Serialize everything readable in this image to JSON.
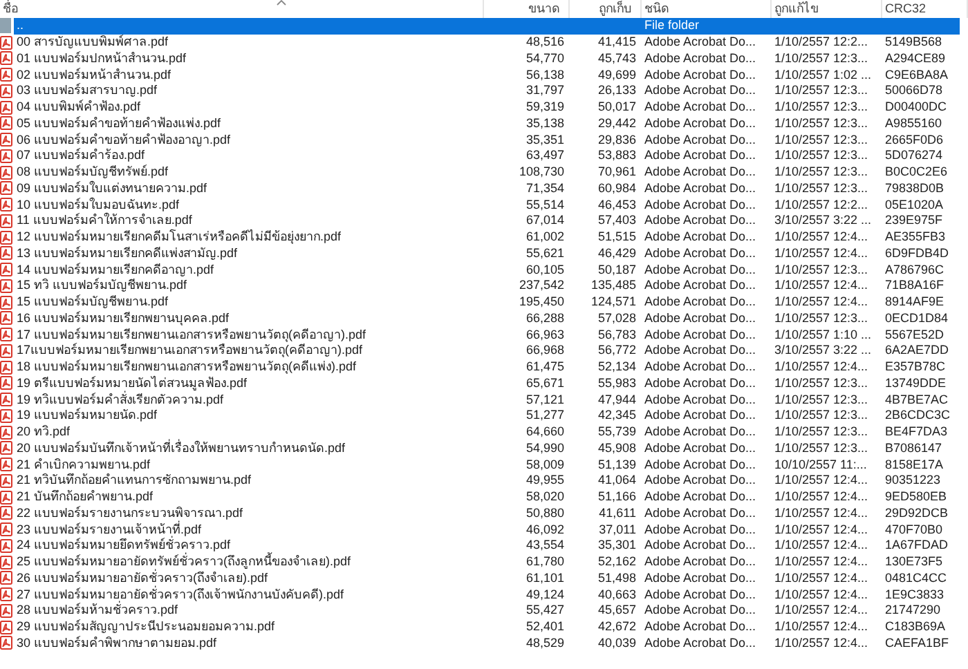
{
  "columns": [
    "ชื่อ",
    "ขนาด",
    "ถูกเก็บ",
    "ชนิด",
    "ถูกแก้ไข",
    "CRC32"
  ],
  "rows": [
    {
      "kind": "folder",
      "name": "..",
      "type": "File folder",
      "selected": true
    },
    {
      "kind": "pdf",
      "name": "00 สารบัญแบบพิมพ์ศาล.pdf",
      "size": "48,516",
      "packed": "41,415",
      "type": "Adobe Acrobat Do...",
      "modified": "1/10/2557 12:2...",
      "crc": "5149B568",
      "selected": false
    },
    {
      "kind": "pdf",
      "name": "01 แบบฟอร์มปกหน้าสำนวน.pdf",
      "size": "54,770",
      "packed": "45,743",
      "type": "Adobe Acrobat Do...",
      "modified": "1/10/2557 12:3...",
      "crc": "A294CE89",
      "selected": false
    },
    {
      "kind": "pdf",
      "name": "02 แบบฟอร์มหน้าสำนวน.pdf",
      "size": "56,138",
      "packed": "49,699",
      "type": "Adobe Acrobat Do...",
      "modified": "1/10/2557 1:02 ...",
      "crc": "C9E6BA8A",
      "selected": false
    },
    {
      "kind": "pdf",
      "name": "03 แบบฟอร์มสารบาญ.pdf",
      "size": "31,797",
      "packed": "26,133",
      "type": "Adobe Acrobat Do...",
      "modified": "1/10/2557 12:3...",
      "crc": "50066D78",
      "selected": false
    },
    {
      "kind": "pdf",
      "name": "04 แบบพิมพ์คำฟ้อง.pdf",
      "size": "59,319",
      "packed": "50,017",
      "type": "Adobe Acrobat Do...",
      "modified": "1/10/2557 12:3...",
      "crc": "D00400DC",
      "selected": false
    },
    {
      "kind": "pdf",
      "name": "05 แบบฟอร์มคำขอท้ายคำฟ้องแพ่ง.pdf",
      "size": "35,138",
      "packed": "29,442",
      "type": "Adobe Acrobat Do...",
      "modified": "1/10/2557 12:3...",
      "crc": "A9855160",
      "selected": false
    },
    {
      "kind": "pdf",
      "name": "06 แบบฟอร์มคำขอท้ายคำฟ้องอาญา.pdf",
      "size": "35,351",
      "packed": "29,836",
      "type": "Adobe Acrobat Do...",
      "modified": "1/10/2557 12:3...",
      "crc": "2665F0D6",
      "selected": false
    },
    {
      "kind": "pdf",
      "name": "07 แบบฟอร์มคำร้อง.pdf",
      "size": "63,497",
      "packed": "53,883",
      "type": "Adobe Acrobat Do...",
      "modified": "1/10/2557 12:3...",
      "crc": "5D076274",
      "selected": false
    },
    {
      "kind": "pdf",
      "name": "08 แบบฟอร์มบัญชีทรัพย์.pdf",
      "size": "108,730",
      "packed": "70,961",
      "type": "Adobe Acrobat Do...",
      "modified": "1/10/2557 12:3...",
      "crc": "B0C0C2E6",
      "selected": false
    },
    {
      "kind": "pdf",
      "name": "09 แบบฟอร์มใบแต่งทนายความ.pdf",
      "size": "71,354",
      "packed": "60,984",
      "type": "Adobe Acrobat Do...",
      "modified": "1/10/2557 12:3...",
      "crc": "79838D0B",
      "selected": false
    },
    {
      "kind": "pdf",
      "name": "10 แบบฟอร์มใบมอบฉันทะ.pdf",
      "size": "55,514",
      "packed": "46,453",
      "type": "Adobe Acrobat Do...",
      "modified": "1/10/2557 12:2...",
      "crc": "05E1020A",
      "selected": false
    },
    {
      "kind": "pdf",
      "name": "11 แบบฟอร์มคำให้การจำเลย.pdf",
      "size": "67,014",
      "packed": "57,403",
      "type": "Adobe Acrobat Do...",
      "modified": "3/10/2557 3:22 ...",
      "crc": "239E975F",
      "selected": false
    },
    {
      "kind": "pdf",
      "name": "12 แบบฟอร์มหมายเรียกคดีมโนสาเร่หรือคดีไม่มีข้อยุ่งยาก.pdf",
      "size": "61,002",
      "packed": "51,515",
      "type": "Adobe Acrobat Do...",
      "modified": "1/10/2557 12:4...",
      "crc": "AE355FB3",
      "selected": false
    },
    {
      "kind": "pdf",
      "name": "13 แบบฟอร์มหมายเรียกคดีแพ่งสามัญ.pdf",
      "size": "55,621",
      "packed": "46,429",
      "type": "Adobe Acrobat Do...",
      "modified": "1/10/2557 12:4...",
      "crc": "6D9FDB4D",
      "selected": false
    },
    {
      "kind": "pdf",
      "name": "14 แบบฟอร์มหมายเรียกคดีอาญา.pdf",
      "size": "60,105",
      "packed": "50,187",
      "type": "Adobe Acrobat Do...",
      "modified": "1/10/2557 12:3...",
      "crc": "A786796C",
      "selected": false
    },
    {
      "kind": "pdf",
      "name": "15 ทวิ แบบฟอร์มบัญชีพยาน.pdf",
      "size": "237,542",
      "packed": "135,485",
      "type": "Adobe Acrobat Do...",
      "modified": "1/10/2557 12:4...",
      "crc": "71B8A16F",
      "selected": false
    },
    {
      "kind": "pdf",
      "name": "15 แบบฟอร์มบัญชีพยาน.pdf",
      "size": "195,450",
      "packed": "124,571",
      "type": "Adobe Acrobat Do...",
      "modified": "1/10/2557 12:4...",
      "crc": "8914AF9E",
      "selected": false
    },
    {
      "kind": "pdf",
      "name": "16 แบบฟอร์มหมายเรียกพยานบุคคล.pdf",
      "size": "66,288",
      "packed": "57,028",
      "type": "Adobe Acrobat Do...",
      "modified": "1/10/2557 12:3...",
      "crc": "0ECD1D84",
      "selected": false
    },
    {
      "kind": "pdf",
      "name": "17 แบบฟอร์มหมายเรียกพยานเอกสารหรือพยานวัตถุ(คดีอาญา).pdf",
      "size": "66,963",
      "packed": "56,783",
      "type": "Adobe Acrobat Do...",
      "modified": "1/10/2557 1:10 ...",
      "crc": "5567E52D",
      "selected": false
    },
    {
      "kind": "pdf",
      "name": "17แบบฟอร์มหมายเรียกพยานเอกสารหรือพยานวัตถุ(คดีอาญา).pdf",
      "size": "66,968",
      "packed": "56,772",
      "type": "Adobe Acrobat Do...",
      "modified": "3/10/2557 3:22 ...",
      "crc": "6A2AE7DD",
      "selected": false
    },
    {
      "kind": "pdf",
      "name": "18 แบบฟอร์มหมายเรียกพยานเอกสารหรือพยานวัตถุ(คดีแพ่ง).pdf",
      "size": "61,475",
      "packed": "52,134",
      "type": "Adobe Acrobat Do...",
      "modified": "1/10/2557 12:4...",
      "crc": "E357B78C",
      "selected": false
    },
    {
      "kind": "pdf",
      "name": "19 ตรีแบบฟอร์มหมายนัดไต่สวนมูลฟ้อง.pdf",
      "size": "65,671",
      "packed": "55,983",
      "type": "Adobe Acrobat Do...",
      "modified": "1/10/2557 12:3...",
      "crc": "13749DDE",
      "selected": false
    },
    {
      "kind": "pdf",
      "name": "19 ทวิแบบฟอร์มคำสั่งเรียกตัวความ.pdf",
      "size": "57,121",
      "packed": "47,944",
      "type": "Adobe Acrobat Do...",
      "modified": "1/10/2557 12:3...",
      "crc": "4B7BE7AC",
      "selected": false
    },
    {
      "kind": "pdf",
      "name": "19 แบบฟอร์มหมายนัด.pdf",
      "size": "51,277",
      "packed": "42,345",
      "type": "Adobe Acrobat Do...",
      "modified": "1/10/2557 12:3...",
      "crc": "2B6CDC3C",
      "selected": false
    },
    {
      "kind": "pdf",
      "name": "20 ทวิ.pdf",
      "size": "64,660",
      "packed": "55,739",
      "type": "Adobe Acrobat Do...",
      "modified": "1/10/2557 12:3...",
      "crc": "BE4F7DA3",
      "selected": false
    },
    {
      "kind": "pdf",
      "name": "20 แบบฟอร์มบันทึกเจ้าหน้าที่เรื่องให้พยานทราบกำหนดนัด.pdf",
      "size": "54,990",
      "packed": "45,908",
      "type": "Adobe Acrobat Do...",
      "modified": "1/10/2557 12:3...",
      "crc": "B7086147",
      "selected": false
    },
    {
      "kind": "pdf",
      "name": "21 คำเบิกความพยาน.pdf",
      "size": "58,009",
      "packed": "51,139",
      "type": "Adobe Acrobat Do...",
      "modified": "10/10/2557 11:...",
      "crc": "8158E17A",
      "selected": false
    },
    {
      "kind": "pdf",
      "name": "21 ทวิบันทึกถ้อยคำแทนการซักถามพยาน.pdf",
      "size": "49,955",
      "packed": "41,064",
      "type": "Adobe Acrobat Do...",
      "modified": "1/10/2557 12:4...",
      "crc": "90351223",
      "selected": false
    },
    {
      "kind": "pdf",
      "name": "21 บันทึกถ้อยคำพยาน.pdf",
      "size": "58,020",
      "packed": "51,166",
      "type": "Adobe Acrobat Do...",
      "modified": "1/10/2557 12:4...",
      "crc": "9ED580EB",
      "selected": false
    },
    {
      "kind": "pdf",
      "name": "22 แบบฟอร์มรายงานกระบวนพิจารณา.pdf",
      "size": "50,880",
      "packed": "41,611",
      "type": "Adobe Acrobat Do...",
      "modified": "1/10/2557 12:4...",
      "crc": "29D92DCB",
      "selected": false
    },
    {
      "kind": "pdf",
      "name": "23 แบบฟอร์มรายงานเจ้าหน้าที่.pdf",
      "size": "46,092",
      "packed": "37,011",
      "type": "Adobe Acrobat Do...",
      "modified": "1/10/2557 12:4...",
      "crc": "470F70B0",
      "selected": false
    },
    {
      "kind": "pdf",
      "name": "24 แบบฟอร์มหมายยึดทรัพย์ชั่วคราว.pdf",
      "size": "43,554",
      "packed": "35,301",
      "type": "Adobe Acrobat Do...",
      "modified": "1/10/2557 12:4...",
      "crc": "1A67FDAD",
      "selected": false
    },
    {
      "kind": "pdf",
      "name": "25 แบบฟอร์มหมายอายัดทรัพย์ชั่วคราว(ถึงลูกหนี้ของจำเลย).pdf",
      "size": "61,780",
      "packed": "52,162",
      "type": "Adobe Acrobat Do...",
      "modified": "1/10/2557 12:4...",
      "crc": "130E73F5",
      "selected": false
    },
    {
      "kind": "pdf",
      "name": "26 แบบฟอร์มหมายอายัดชั่วคราว(ถึงจำเลย).pdf",
      "size": "61,101",
      "packed": "51,498",
      "type": "Adobe Acrobat Do...",
      "modified": "1/10/2557 12:4...",
      "crc": "0481C4CC",
      "selected": false
    },
    {
      "kind": "pdf",
      "name": "27 แบบฟอร์มหมายอายัดชั่วคราว(ถึงเจ้าพนักงานบังคับคดี).pdf",
      "size": "49,124",
      "packed": "40,663",
      "type": "Adobe Acrobat Do...",
      "modified": "1/10/2557 12:4...",
      "crc": "1E9C3833",
      "selected": false
    },
    {
      "kind": "pdf",
      "name": "28 แบบฟอร์มห้ามชั่วคราว.pdf",
      "size": "55,427",
      "packed": "45,657",
      "type": "Adobe Acrobat Do...",
      "modified": "1/10/2557 12:4...",
      "crc": "21747290",
      "selected": false
    },
    {
      "kind": "pdf",
      "name": "29 แบบฟอร์มสัญญาประนีประนอมยอมความ.pdf",
      "size": "52,401",
      "packed": "42,672",
      "type": "Adobe Acrobat Do...",
      "modified": "1/10/2557 12:4...",
      "crc": "C183B69A",
      "selected": false
    },
    {
      "kind": "pdf",
      "name": "30 แบบฟอร์มคำพิพากษาตามยอม.pdf",
      "size": "48,529",
      "packed": "40,039",
      "type": "Adobe Acrobat Do...",
      "modified": "1/10/2557 12:4...",
      "crc": "CAEFA1BF",
      "selected": false
    }
  ]
}
